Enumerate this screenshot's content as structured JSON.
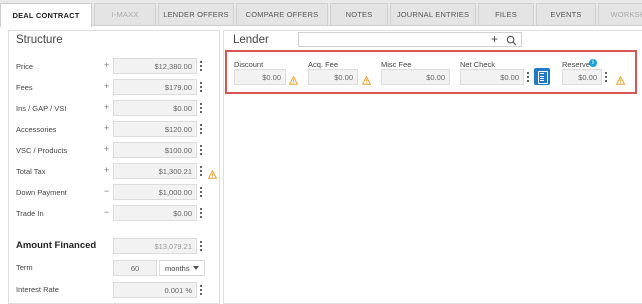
{
  "tabs": [
    "DEAL CONTRACT",
    "I-MAXX",
    "LENDER OFFERS",
    "COMPARE OFFERS",
    "NOTES",
    "JOURNAL ENTRIES",
    "FILES",
    "EVENTS",
    "WORKSH"
  ],
  "structure": {
    "title": "Structure",
    "rows": [
      {
        "label": "Price",
        "op": "+",
        "value": "$12,380.00"
      },
      {
        "label": "Fees",
        "op": "+",
        "value": "$179.00"
      },
      {
        "label": "Ins / GAP / VSI",
        "op": "+",
        "value": "$0.00"
      },
      {
        "label": "Accessories",
        "op": "+",
        "value": "$120.00"
      },
      {
        "label": "VSC / Products",
        "op": "+",
        "value": "$100.00"
      },
      {
        "label": "Total Tax",
        "op": "+",
        "value": "$1,300.21"
      },
      {
        "label": "Down Payment",
        "op": "−",
        "value": "$1,000.00"
      },
      {
        "label": "Trade In",
        "op": "−",
        "value": "$0.00"
      }
    ],
    "amount_financed": {
      "label": "Amount Financed",
      "value": "$13,079.21"
    },
    "term": {
      "label": "Term",
      "value": "60",
      "unit": "months"
    },
    "interest_rate": {
      "label": "Interest Rate",
      "value": "0.001 %"
    }
  },
  "lender": {
    "title": "Lender",
    "search_value": "",
    "plus_label": "+",
    "fees": [
      {
        "label": "Discount",
        "value": "$0.00"
      },
      {
        "label": "Acq. Fee",
        "value": "$0.00"
      },
      {
        "label": "Misc Fee",
        "value": "$0.00"
      },
      {
        "label": "Net Check",
        "value": "$0.00"
      },
      {
        "label": "Reserve",
        "value": "$0.00"
      }
    ],
    "info_glyph": "i"
  },
  "colors": {
    "accent": "#1f78c8",
    "highlight": "#d9534f",
    "warning": "#f0a030",
    "info": "#19a3d6"
  }
}
